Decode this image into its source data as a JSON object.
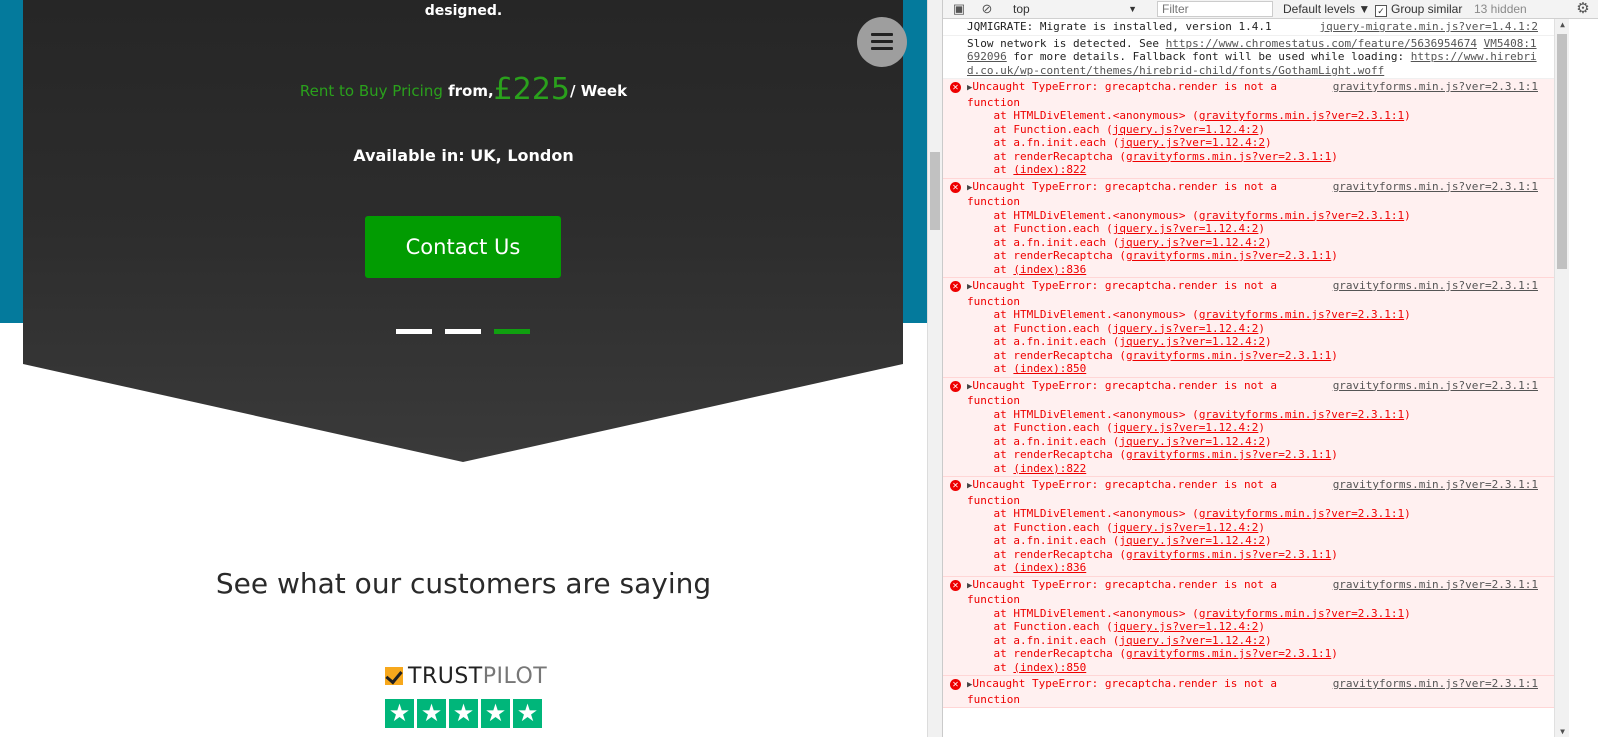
{
  "site": {
    "designed_text": "designed.",
    "pricing": {
      "label": "Rent to Buy Pricing",
      "from_text": "from,",
      "price": "£225",
      "period": "/ Week"
    },
    "availability": "Available in: UK, London",
    "contact_button": "Contact Us",
    "slider_active_index": 3,
    "customers_heading": "See what our customers are saying",
    "trustpilot": {
      "trust": "TRUST",
      "pilot": "PILOT",
      "stars": 5
    }
  },
  "devtools": {
    "toolbar": {
      "context": "top",
      "filter_placeholder": "Filter",
      "levels": "Default levels ▼",
      "group_similar": "Group similar",
      "group_similar_checked": true,
      "hidden_count": "13 hidden"
    },
    "messages": [
      {
        "type": "log",
        "text": "JQMIGRATE: Migrate is installed, version 1.4.1",
        "source": "jquery-migrate.min.js?ver=1.4.1:2"
      },
      {
        "type": "warning-log",
        "line1_pre": "Slow network is detected. See ",
        "line1_link": "https://www.chromestatus.com/feature/5636954674",
        "line1_link2": "VM5408:1",
        "line2_link": "692096",
        "line2_post": " for more details. Fallback font will be used while loading: ",
        "line2_link2": "https://www.hirebri",
        "line3_link": "d.co.uk/wp-content/themes/hirebrid-child/fonts/GothamLight.woff"
      },
      {
        "type": "error",
        "index_line": "(index):822"
      },
      {
        "type": "error",
        "index_line": "(index):836"
      },
      {
        "type": "error",
        "index_line": "(index):850"
      },
      {
        "type": "error",
        "index_line": "(index):822"
      },
      {
        "type": "error",
        "index_line": "(index):836"
      },
      {
        "type": "error",
        "index_line": "(index):850"
      },
      {
        "type": "error",
        "index_line": ""
      }
    ],
    "error_text": {
      "message": "Uncaught TypeError: grecaptcha.render is not a",
      "message_cont": "function",
      "source": "gravityforms.min.js?ver=2.3.1:1",
      "frames": [
        {
          "pre": "at HTMLDivElement.<anonymous> (",
          "link": "gravityforms.min.js?ver=2.3.1:1"
        },
        {
          "pre": "at Function.each (",
          "link": "jquery.js?ver=1.12.4:2"
        },
        {
          "pre": "at a.fn.init.each (",
          "link": "jquery.js?ver=1.12.4:2"
        },
        {
          "pre": "at renderRecaptcha (",
          "link": "gravityforms.min.js?ver=2.3.1:1"
        }
      ],
      "at": "at "
    }
  }
}
